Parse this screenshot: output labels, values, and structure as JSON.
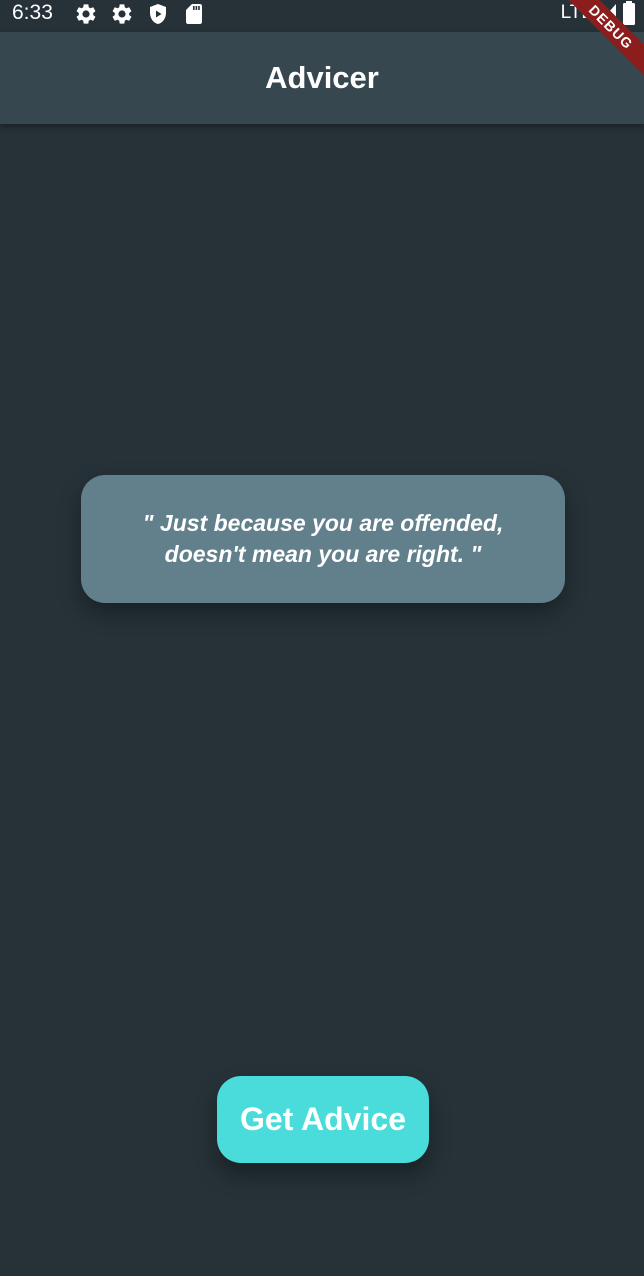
{
  "status_bar": {
    "time": "6:33",
    "network": "LTE",
    "icons": [
      "settings-icon",
      "settings-icon",
      "play-protect-icon",
      "sd-card-icon",
      "signal-icon",
      "battery-icon"
    ]
  },
  "app_bar": {
    "title": "Advicer"
  },
  "debug_banner": {
    "label": "DEBUG"
  },
  "advice": {
    "text": "\" Just because you are offended, doesn't mean you are right. \""
  },
  "actions": {
    "get_advice_label": "Get Advice"
  },
  "colors": {
    "background": "#263238",
    "app_bar": "#37474f",
    "card": "#62808c",
    "button": "#4adbdb",
    "debug_banner": "#8b1d1d"
  }
}
